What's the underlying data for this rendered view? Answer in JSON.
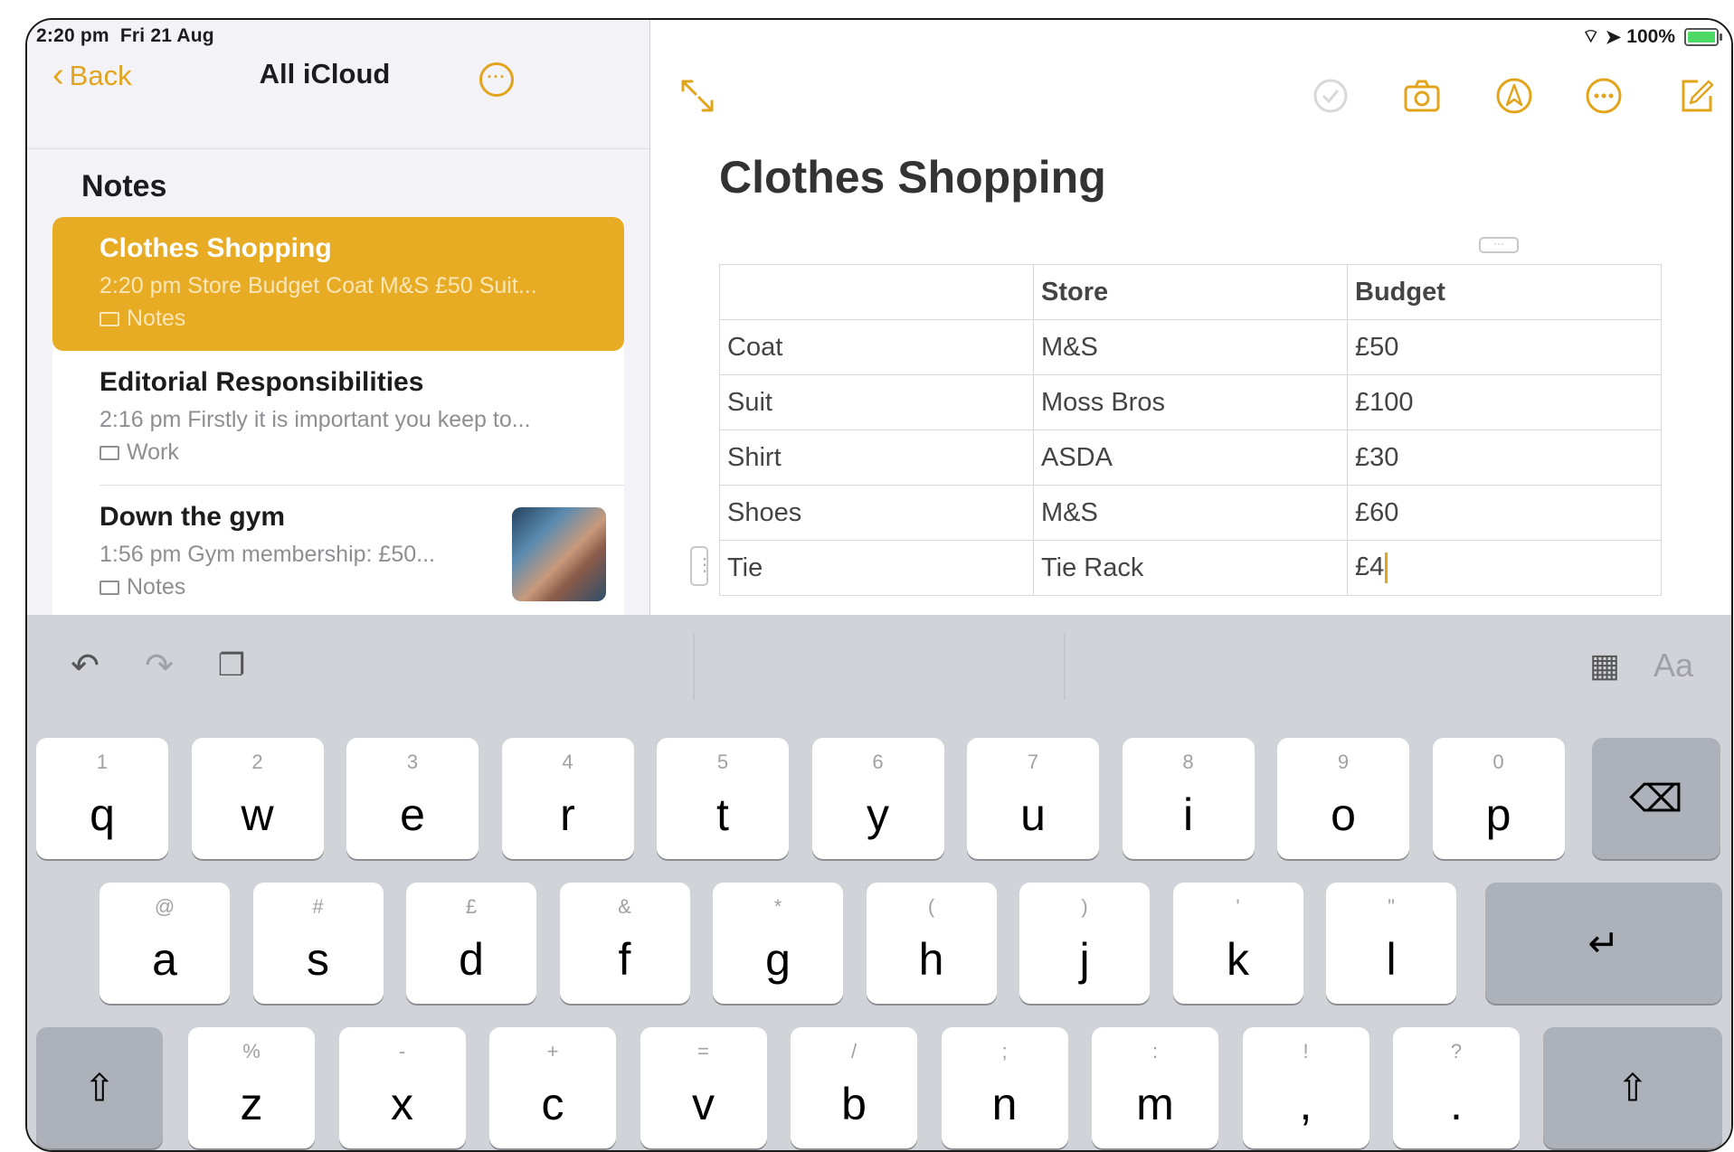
{
  "status_bar": {
    "time": "2:20 pm",
    "date": "Fri 21 Aug",
    "battery": "100%"
  },
  "sidebar": {
    "back_label": "Back",
    "title": "All iCloud",
    "heading": "Notes",
    "notes": [
      {
        "title": "Clothes Shopping",
        "preview": "2:20 pm  Store Budget Coat M&S £50 Suit...",
        "folder": "Notes",
        "selected": true
      },
      {
        "title": "Editorial Responsibilities",
        "preview": "2:16 pm  Firstly it is important you keep to...",
        "folder": "Work"
      },
      {
        "title": "Down the gym",
        "preview": "1:56 pm  Gym membership: £50...",
        "folder": "Notes",
        "has_thumbnail": true
      }
    ]
  },
  "editor": {
    "title": "Clothes Shopping",
    "table": {
      "headers": [
        "",
        "Store",
        "Budget"
      ],
      "rows": [
        [
          "Coat",
          "M&S",
          "£50"
        ],
        [
          "Suit",
          "Moss Bros",
          "£100"
        ],
        [
          "Shirt",
          "ASDA",
          "£30"
        ],
        [
          "Shoes",
          "M&S",
          "£60"
        ],
        [
          "Tie",
          "Tie Rack",
          "£4"
        ]
      ]
    },
    "toolbar_icons": [
      "expand-icon",
      "checklist-icon",
      "camera-icon",
      "markup-icon",
      "more-icon",
      "compose-icon"
    ]
  },
  "keyboard": {
    "format_label": "Aa",
    "row1": [
      {
        "alt": "1",
        "key": "q"
      },
      {
        "alt": "2",
        "key": "w"
      },
      {
        "alt": "3",
        "key": "e"
      },
      {
        "alt": "4",
        "key": "r"
      },
      {
        "alt": "5",
        "key": "t"
      },
      {
        "alt": "6",
        "key": "y"
      },
      {
        "alt": "7",
        "key": "u"
      },
      {
        "alt": "8",
        "key": "i"
      },
      {
        "alt": "9",
        "key": "o"
      },
      {
        "alt": "0",
        "key": "p"
      }
    ],
    "row2": [
      {
        "alt": "@",
        "key": "a"
      },
      {
        "alt": "#",
        "key": "s"
      },
      {
        "alt": "£",
        "key": "d"
      },
      {
        "alt": "&",
        "key": "f"
      },
      {
        "alt": "*",
        "key": "g"
      },
      {
        "alt": "(",
        "key": "h"
      },
      {
        "alt": ")",
        "key": "j"
      },
      {
        "alt": "'",
        "key": "k"
      },
      {
        "alt": "\"",
        "key": "l"
      }
    ],
    "row3": [
      {
        "alt": "%",
        "key": "z"
      },
      {
        "alt": "-",
        "key": "x"
      },
      {
        "alt": "+",
        "key": "c"
      },
      {
        "alt": "=",
        "key": "v"
      },
      {
        "alt": "/",
        "key": "b"
      },
      {
        "alt": ";",
        "key": "n"
      },
      {
        "alt": ":",
        "key": "m"
      },
      {
        "alt": "!",
        "key": ","
      },
      {
        "alt": "?",
        "key": "."
      }
    ]
  },
  "colors": {
    "accent": "#e2a41b",
    "selected_note": "#e7ac24",
    "keyboard_bg": "#d1d3d9"
  }
}
